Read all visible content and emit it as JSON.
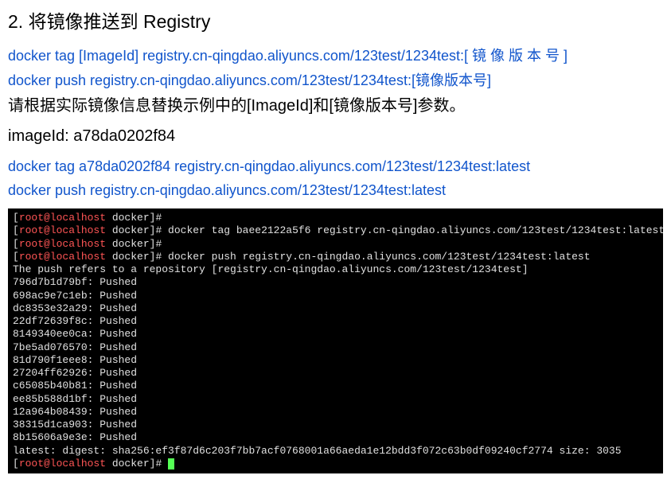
{
  "heading": "2.  将镜像推送到 Registry",
  "cmds": {
    "tag_template": "docker   tag    [ImageId]    registry.cn-qingdao.aliyuncs.com/123test/1234test:[ 镜 像 版 本 号 ]",
    "push_template": "docker push registry.cn-qingdao.aliyuncs.com/123test/1234test:[镜像版本号]"
  },
  "instruction": "请根据实际镜像信息替换示例中的[ImageId]和[镜像版本号]参数。",
  "imageid_line": "imageId: a78da0202f84",
  "cmds_actual": {
    "tag": "docker tag a78da0202f84 registry.cn-qingdao.aliyuncs.com/123test/1234test:latest",
    "push": "docker push registry.cn-qingdao.aliyuncs.com/123test/1234test:latest"
  },
  "terminal": {
    "prompt_user": "root@localhost",
    "prompt_dir": "docker",
    "lines": [
      {
        "type": "prompt",
        "cmd": ""
      },
      {
        "type": "prompt",
        "cmd": "docker tag baee2122a5f6 registry.cn-qingdao.aliyuncs.com/123test/1234test:latest"
      },
      {
        "type": "prompt",
        "cmd": ""
      },
      {
        "type": "prompt",
        "cmd": "docker push registry.cn-qingdao.aliyuncs.com/123test/1234test:latest"
      },
      {
        "type": "output",
        "text": "The push refers to a repository [registry.cn-qingdao.aliyuncs.com/123test/1234test]"
      },
      {
        "type": "output",
        "text": "796d7b1d79bf: Pushed"
      },
      {
        "type": "output",
        "text": "698ac9e7c1eb: Pushed"
      },
      {
        "type": "output",
        "text": "dc8353e32a29: Pushed"
      },
      {
        "type": "output",
        "text": "22df72639f8c: Pushed"
      },
      {
        "type": "output",
        "text": "8149340ee0ca: Pushed"
      },
      {
        "type": "output",
        "text": "7be5ad076570: Pushed"
      },
      {
        "type": "output",
        "text": "81d790f1eee8: Pushed"
      },
      {
        "type": "output",
        "text": "27204ff62926: Pushed"
      },
      {
        "type": "output",
        "text": "c65085b40b81: Pushed"
      },
      {
        "type": "output",
        "text": "ee85b588d1bf: Pushed"
      },
      {
        "type": "output",
        "text": "12a964b08439: Pushed"
      },
      {
        "type": "output",
        "text": "38315d1ca903: Pushed"
      },
      {
        "type": "output",
        "text": "8b15606a9e3e: Pushed"
      },
      {
        "type": "output",
        "text": "latest: digest: sha256:ef3f87d6c203f7bb7acf0768001a66aeda1e12bdd3f072c63b0df09240cf2774 size: 3035"
      },
      {
        "type": "prompt",
        "cmd": "",
        "cursor": true
      }
    ]
  }
}
